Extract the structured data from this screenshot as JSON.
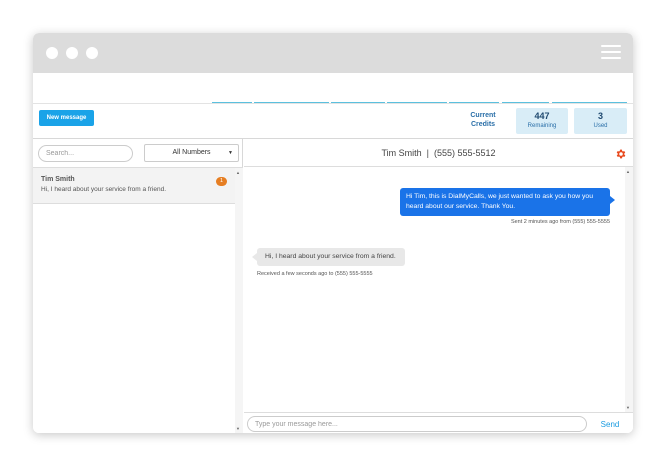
{
  "toolbar": {
    "new_message_label": "New message"
  },
  "credits": {
    "label_line1": "Current",
    "label_line2": "Credits",
    "remaining_value": "447",
    "remaining_label": "Remaining",
    "used_value": "3",
    "used_label": "Used"
  },
  "sidebar": {
    "search_placeholder": "Search...",
    "filter_selected": "All Numbers",
    "conversations": [
      {
        "name": "Tim Smith",
        "preview": "Hi, I heard about your service from a friend.",
        "unread": "1"
      }
    ]
  },
  "chat": {
    "title": "Tim Smith  |  (555) 555-5512",
    "messages": [
      {
        "direction": "out",
        "text": "Hi Tim, this is DialMyCalls, we just wanted to ask you how you heard about our service. Thank You.",
        "meta": "Sent 2 minutes ago from (555) 555-5555"
      },
      {
        "direction": "in",
        "text": "Hi, I heard about your service from a friend.",
        "meta": "Received a few seconds ago to (555) 555-5555"
      }
    ],
    "input_placeholder": "Type your message here...",
    "send_label": "Send"
  },
  "colors": {
    "accent": "#1aa3e8",
    "outgoing_bubble": "#1a73e8",
    "badge": "#e67e22",
    "gear": "#e8491d"
  }
}
